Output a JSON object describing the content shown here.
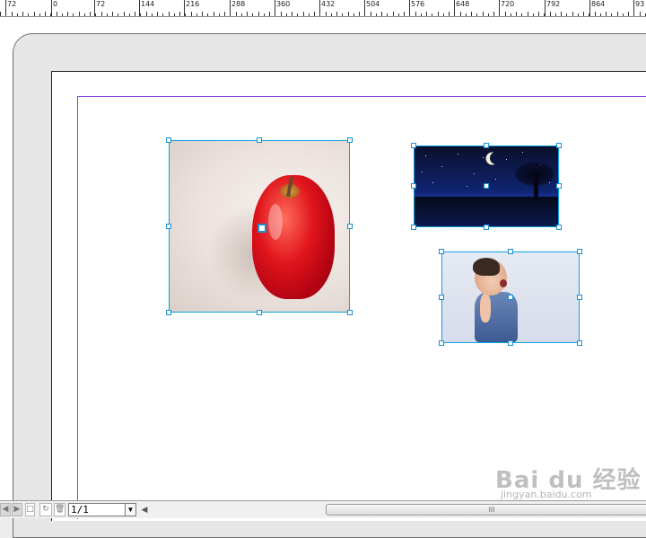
{
  "ruler": {
    "labels": [
      "72",
      "0",
      "72",
      "144",
      "216",
      "288",
      "360",
      "432",
      "504",
      "576",
      "648",
      "720",
      "792",
      "864",
      "93"
    ]
  },
  "page_nav": {
    "page_value": "1/1"
  },
  "scrollbar": {
    "thumb_grip": "III"
  },
  "watermark": {
    "brand": "Bai du 经验",
    "url": "jingyan.baidu.com"
  },
  "colors": {
    "frame_border": "#0aa0e0",
    "margin_guide": "#8a3fd0",
    "pasteboard": "#e6e6e6"
  },
  "icons": [
    "first-page-icon",
    "last-page-icon",
    "add-page-icon",
    "refresh-icon",
    "delete-page-icon",
    "dropdown-arrow-icon",
    "scroll-left-arrow-icon"
  ]
}
